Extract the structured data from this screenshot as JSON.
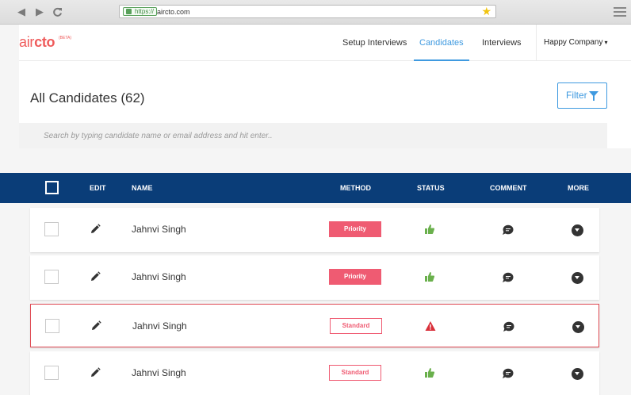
{
  "browser": {
    "back_icon": "back-arrow-icon",
    "forward_icon": "forward-arrow-icon",
    "reload_icon": "reload-icon",
    "protocol": "https://",
    "url": "aircto.com",
    "bookmark_icon": "star-icon",
    "menu_icon": "hamburger-menu-icon"
  },
  "header": {
    "logo_part1": "air",
    "logo_part2": "cto",
    "logo_badge": "(BETA)",
    "nav": [
      {
        "label": "Setup Interviews",
        "active": false
      },
      {
        "label": "Candidates",
        "active": true
      },
      {
        "label": "Interviews",
        "active": false
      }
    ],
    "company": "Happy Company",
    "colors": {
      "brand": "#ef5b5b",
      "accent": "#3f9ae0"
    }
  },
  "page": {
    "title": "All Candidates (62)",
    "filter_label": "Filter",
    "search_placeholder": "Search by typing candidate name or email address and hit enter.."
  },
  "table": {
    "header_color": "#0a3d78",
    "columns": {
      "edit": "EDIT",
      "name": "NAME",
      "method": "METHOD",
      "status": "STATUS",
      "comment": "COMMENT",
      "more": "MORE"
    },
    "rows": [
      {
        "name": "Jahnvi Singh",
        "method": "Priority",
        "method_style": "filled",
        "status": "thumbs-up-icon"
      },
      {
        "name": "Jahnvi Singh",
        "method": "Priority",
        "method_style": "filled",
        "status": "thumbs-up-icon"
      },
      {
        "name": "Jahnvi Singh",
        "method": "Standard",
        "method_style": "outline",
        "status": "warning-icon",
        "flagged": true
      },
      {
        "name": "Jahnvi Singh",
        "method": "Standard",
        "method_style": "outline",
        "status": "thumbs-up-icon"
      }
    ]
  }
}
